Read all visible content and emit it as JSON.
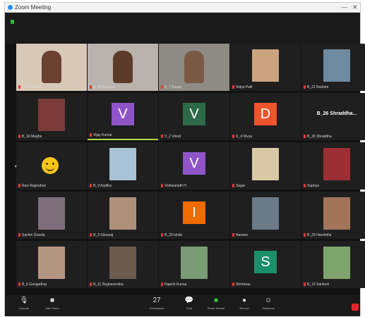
{
  "window": {
    "title": "Zoom Meeting",
    "minimize_icon": "—",
    "close_icon": "✕"
  },
  "colors": {
    "background": "#121212",
    "tile": "#1f1f1f",
    "active_border": "#b7d94a",
    "muted_mic": "#e53935",
    "leave": "#e02828"
  },
  "participants": [
    {
      "name": "B_1 Deepika",
      "kind": "video",
      "bg": "#d8c9b6",
      "skin": "#6b4232",
      "active": true
    },
    {
      "name": "B_18 Prakash",
      "kind": "video",
      "bg": "#b9b3ad",
      "skin": "#5c3b2a"
    },
    {
      "name": "B_7 Kavya",
      "kind": "video",
      "bg": "#8f8c86",
      "skin": "#7a5a45"
    },
    {
      "name": "Vidya Patil",
      "kind": "photo",
      "bg": "#1f1f1f",
      "skin": "#caa37f"
    },
    {
      "name": "B_22 Rashmi",
      "kind": "photo",
      "bg": "#1f1f1f",
      "skin": "#6d8aa0"
    },
    {
      "name": "B_16 Megha",
      "kind": "photo",
      "bg": "#1f1f1f",
      "skin": "#7b3b38"
    },
    {
      "name": "Vijay Kumar",
      "kind": "avatar",
      "letter": "V",
      "color": "#8e54c8",
      "speaking": true
    },
    {
      "name": "V_2 Vinod",
      "kind": "avatar",
      "letter": "V",
      "color": "#2d6a47"
    },
    {
      "name": "D_4 Divya",
      "kind": "avatar",
      "letter": "D",
      "color": "#f0542c"
    },
    {
      "name": "B_26 Shraddha",
      "kind": "text",
      "big": "B_26 Shraddha..."
    },
    {
      "name": "Ravi Rajendran",
      "kind": "emoji"
    },
    {
      "name": "B_9 Arpitha",
      "kind": "photo",
      "bg": "#1f1f1f",
      "skin": "#a8c3d6"
    },
    {
      "name": "Vishwanath H",
      "kind": "avatar",
      "letter": "V",
      "color": "#8e54c8"
    },
    {
      "name": "Sagar",
      "kind": "photo",
      "bg": "#1f1f1f",
      "skin": "#d8c8a6"
    },
    {
      "name": "Supriya",
      "kind": "photo",
      "bg": "#1f1f1f",
      "skin": "#9b2f34"
    },
    {
      "name": "Sachin Gowda",
      "kind": "photo",
      "bg": "#1f1f1f",
      "skin": "#7d6e7b"
    },
    {
      "name": "B_3 Shivaraj",
      "kind": "photo",
      "bg": "#1f1f1f",
      "skin": "#b08f7a"
    },
    {
      "name": "B_30 Ishita",
      "kind": "avatar",
      "letter": "I",
      "color": "#ef6c00"
    },
    {
      "name": "Naveen",
      "kind": "photo",
      "bg": "#1f1f1f",
      "skin": "#6a7a88"
    },
    {
      "name": "B_29 Harshitha",
      "kind": "photo",
      "bg": "#1f1f1f",
      "skin": "#a27459"
    },
    {
      "name": "B_5 Gangadhar",
      "kind": "photo",
      "bg": "#1f1f1f",
      "skin": "#b59681"
    },
    {
      "name": "B_11 Raghavendra",
      "kind": "photo",
      "bg": "#1f1f1f",
      "skin": "#6c5a4f"
    },
    {
      "name": "Rajesh Kumar",
      "kind": "photo",
      "bg": "#1f1f1f",
      "skin": "#7b9a76"
    },
    {
      "name": "Shrinivas",
      "kind": "avatar",
      "letter": "S",
      "color": "#1a8f6a"
    },
    {
      "name": "B_19 Santosh",
      "kind": "photo",
      "bg": "#1f1f1f",
      "skin": "#7fa36d"
    }
  ],
  "toolbar": {
    "mute": {
      "label": "Unmute",
      "icon": "microphone-icon"
    },
    "video": {
      "label": "Start Video",
      "icon": "video-camera-icon"
    },
    "participants": {
      "label": "Participants",
      "count": "27",
      "icon": "participants-icon"
    },
    "chat": {
      "label": "Chat",
      "icon": "chat-icon"
    },
    "share": {
      "label": "Share Screen",
      "icon": "share-screen-icon"
    },
    "record": {
      "label": "Record",
      "icon": "record-icon"
    },
    "reactions": {
      "label": "Reactions",
      "icon": "reactions-icon"
    }
  }
}
